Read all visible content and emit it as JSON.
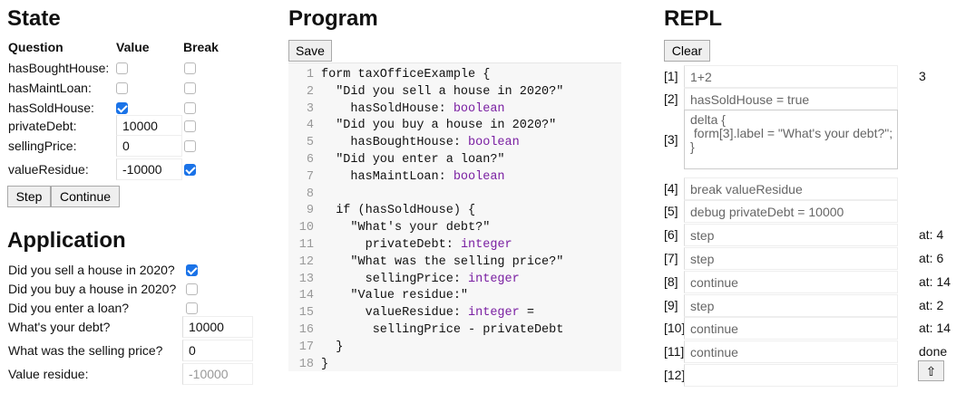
{
  "state": {
    "title": "State",
    "headers": {
      "question": "Question",
      "value": "Value",
      "break": "Break"
    },
    "rows": [
      {
        "label": "hasBoughtHouse:",
        "kind": "checkbox",
        "checked": false,
        "break": false
      },
      {
        "label": "hasMaintLoan:",
        "kind": "checkbox",
        "checked": false,
        "break": false
      },
      {
        "label": "hasSoldHouse:",
        "kind": "checkbox",
        "checked": true,
        "break": false
      },
      {
        "label": "privateDebt:",
        "kind": "input",
        "value": "10000",
        "break": false
      },
      {
        "label": "sellingPrice:",
        "kind": "input",
        "value": "0",
        "break": false
      },
      {
        "label": "valueResidue:",
        "kind": "input",
        "value": "-10000",
        "break": true
      }
    ],
    "step_label": "Step",
    "continue_label": "Continue"
  },
  "application": {
    "title": "Application",
    "questions": [
      {
        "label": "Did you sell a house in 2020?",
        "kind": "checkbox",
        "checked": true
      },
      {
        "label": "Did you buy a house in 2020?",
        "kind": "checkbox",
        "checked": false
      },
      {
        "label": "Did you enter a loan?",
        "kind": "checkbox",
        "checked": false
      },
      {
        "label": "What's your debt?",
        "kind": "input",
        "value": "10000"
      },
      {
        "label": "What was the selling price?",
        "kind": "input",
        "value": "0"
      },
      {
        "label": "Value residue:",
        "kind": "input",
        "value": "-10000",
        "readonly": true
      }
    ]
  },
  "program": {
    "title": "Program",
    "save_label": "Save",
    "lines": [
      [
        {
          "t": "form taxOfficeExample {"
        }
      ],
      [
        {
          "t": "  \"Did you sell a house in 2020?\""
        }
      ],
      [
        {
          "t": "    hasSoldHouse: "
        },
        {
          "t": "boolean",
          "k": 1
        }
      ],
      [
        {
          "t": "  \"Did you buy a house in 2020?\""
        }
      ],
      [
        {
          "t": "    hasBoughtHouse: "
        },
        {
          "t": "boolean",
          "k": 1
        }
      ],
      [
        {
          "t": "  \"Did you enter a loan?\""
        }
      ],
      [
        {
          "t": "    hasMaintLoan: "
        },
        {
          "t": "boolean",
          "k": 1
        }
      ],
      [
        {
          "t": ""
        }
      ],
      [
        {
          "t": "  if (hasSoldHouse) {"
        }
      ],
      [
        {
          "t": "    \"What's your debt?\""
        }
      ],
      [
        {
          "t": "      privateDebt: "
        },
        {
          "t": "integer",
          "k": 1
        }
      ],
      [
        {
          "t": "    \"What was the selling price?\""
        }
      ],
      [
        {
          "t": "      sellingPrice: "
        },
        {
          "t": "integer",
          "k": 1
        }
      ],
      [
        {
          "t": "    \"Value residue:\""
        }
      ],
      [
        {
          "t": "      valueResidue: "
        },
        {
          "t": "integer",
          "k": 1
        },
        {
          "t": " ="
        }
      ],
      [
        {
          "t": "       sellingPrice - privateDebt"
        }
      ],
      [
        {
          "t": "  }"
        }
      ],
      [
        {
          "t": "}"
        }
      ]
    ]
  },
  "repl": {
    "title": "REPL",
    "clear_label": "Clear",
    "entries": [
      {
        "idx": "[1]",
        "cmd": "1+2",
        "result": "3"
      },
      {
        "idx": "[2]",
        "cmd": "hasSoldHouse = true",
        "result": ""
      },
      {
        "idx": "[3]",
        "cmd": "delta {\n form[3].label = \"What's your debt?\";\n}",
        "result": "",
        "multiline": true
      },
      {
        "idx": "[4]",
        "cmd": "break valueResidue",
        "result": ""
      },
      {
        "idx": "[5]",
        "cmd": "debug privateDebt = 10000",
        "result": ""
      },
      {
        "idx": "[6]",
        "cmd": "step",
        "result": "at: 4"
      },
      {
        "idx": "[7]",
        "cmd": "step",
        "result": "at: 6"
      },
      {
        "idx": "[8]",
        "cmd": "continue",
        "result": "at: 14"
      },
      {
        "idx": "[9]",
        "cmd": "step",
        "result": "at: 2"
      },
      {
        "idx": "[10]",
        "cmd": "continue",
        "result": "at: 14"
      },
      {
        "idx": "[11]",
        "cmd": "continue",
        "result": "done"
      },
      {
        "idx": "[12]",
        "cmd": "",
        "result": ""
      }
    ],
    "submit_icon": "arrow-up-icon"
  }
}
